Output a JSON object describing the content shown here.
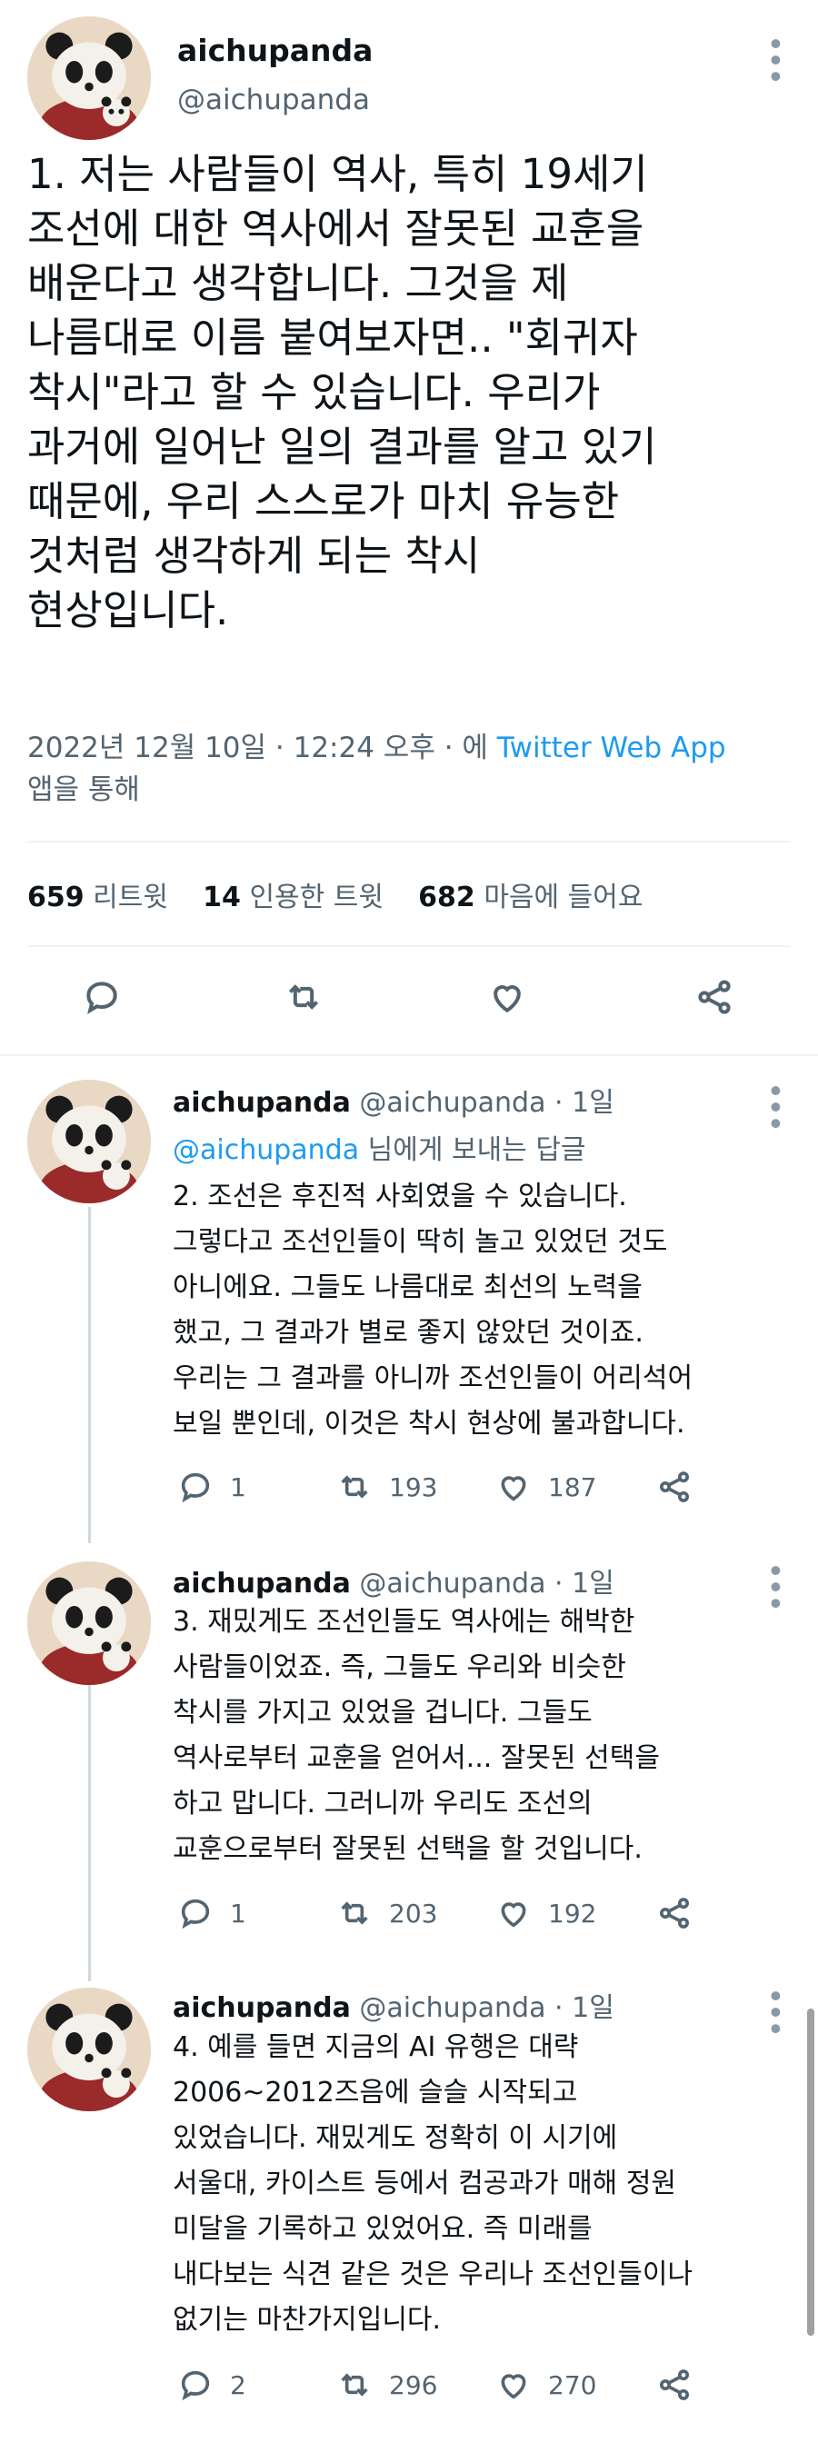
{
  "main": {
    "display_name": "aichupanda",
    "handle": "@aichupanda",
    "text": "1. 저는 사람들이 역사, 특히 19세기\n조선에 대한 역사에서 잘못된 교훈을\n배운다고 생각합니다. 그것을 제\n나름대로 이름 붙여보자면.. \"회귀자\n착시\"라고 할 수 있습니다. 우리가\n과거에 일어난 일의 결과를 알고 있기\n때문에, 우리 스스로가 마치 유능한\n것처럼 생각하게 되는 착시\n현상입니다.",
    "meta_prefix": "2022년 12월 10일 · 12:24 오후 · 에 ",
    "meta_app": "Twitter Web App",
    "meta_suffix": "앱을 통해",
    "retweets_count": "659",
    "retweets_label": "리트윗",
    "quotes_count": "14",
    "quotes_label": "인용한 트윗",
    "likes_count": "682",
    "likes_label": "마음에 들어요",
    "actions": [
      "reply-icon",
      "retweet-icon",
      "like-icon",
      "share-icon"
    ]
  },
  "replies": [
    {
      "display_name": "aichupanda",
      "handle": "@aichupanda",
      "time": "· 1일",
      "reply_to_handle": "@aichupanda",
      "reply_to_suffix": " 님에게 보내는 답글",
      "text": "2. 조선은 후진적 사회였을 수 있습니다.\n그렇다고 조선인들이 딱히 놀고 있었던 것도\n아니에요. 그들도 나름대로 최선의 노력을\n했고, 그 결과가 별로 좋지 않았던 것이죠.\n우리는 그 결과를 아니까 조선인들이 어리석어\n보일 뿐인데, 이것은 착시 현상에 불과합니다.",
      "replies": "1",
      "retweets": "193",
      "likes": "187"
    },
    {
      "display_name": "aichupanda",
      "handle": "@aichupanda",
      "time": "· 1일",
      "text": "3. 재밌게도 조선인들도 역사에는 해박한\n사람들이었죠. 즉, 그들도 우리와 비슷한\n착시를 가지고 있었을 겁니다. 그들도\n역사로부터 교훈을 얻어서... 잘못된 선택을\n하고 맙니다. 그러니까 우리도 조선의\n교훈으로부터 잘못된 선택을 할 것입니다.",
      "replies": "1",
      "retweets": "203",
      "likes": "192"
    },
    {
      "display_name": "aichupanda",
      "handle": "@aichupanda",
      "time": "· 1일",
      "text": "4. 예를 들면 지금의 AI 유행은 대략\n2006~2012즈음에 슬슬 시작되고\n있었습니다. 재밌게도 정확히 이 시기에\n서울대, 카이스트 등에서 컴공과가 매해 정원\n미달을 기록하고 있었어요. 즉 미래를\n내다보는 식견 같은 것은 우리나 조선인들이나\n없기는 마찬가지입니다.",
      "replies": "2",
      "retweets": "296",
      "likes": "270"
    }
  ],
  "colors": {
    "link": "#1d9bf0",
    "muted": "#536471",
    "text": "#0f1419",
    "divider": "#eff3f4"
  }
}
